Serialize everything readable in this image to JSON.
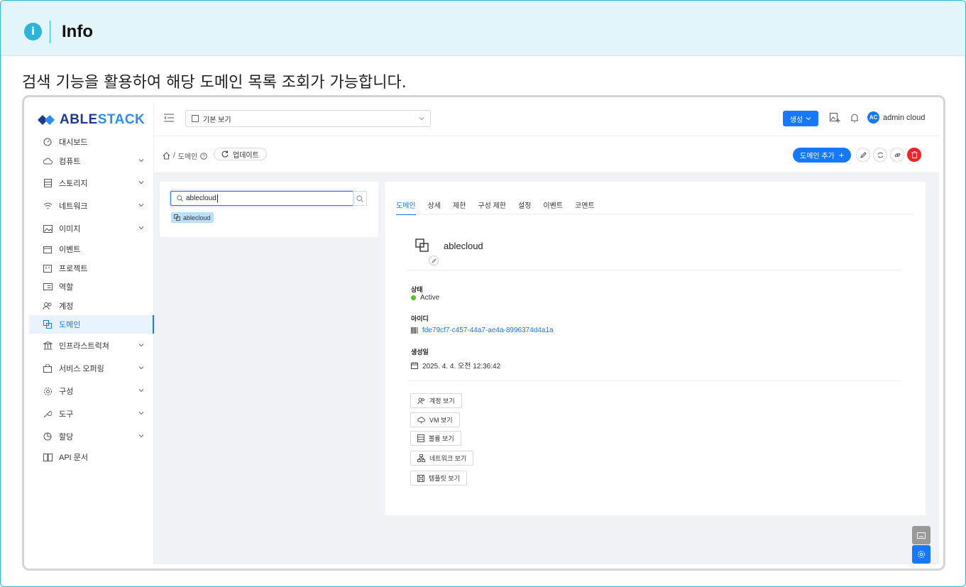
{
  "info": {
    "title": "Info",
    "icon": "info-icon"
  },
  "intro": "검색 기능을 활용하여 해당 도메인 목록 조회가 가능합니다.",
  "brand": {
    "logo_prefix": "ABLE",
    "logo_suffix": "STACK"
  },
  "sidebar": {
    "items": [
      {
        "label": "대시보드",
        "icon": "dashboard-icon",
        "has_children": false
      },
      {
        "label": "컴퓨트",
        "icon": "cloud-icon",
        "has_children": true
      },
      {
        "label": "스토리지",
        "icon": "storage-icon",
        "has_children": true
      },
      {
        "label": "네트워크",
        "icon": "wifi-icon",
        "has_children": true
      },
      {
        "label": "이미지",
        "icon": "image-icon",
        "has_children": true
      },
      {
        "label": "이벤트",
        "icon": "event-icon",
        "has_children": false
      },
      {
        "label": "프로젝트",
        "icon": "project-icon",
        "has_children": false
      },
      {
        "label": "역할",
        "icon": "role-icon",
        "has_children": false
      },
      {
        "label": "계정",
        "icon": "account-icon",
        "has_children": false
      },
      {
        "label": "도메인",
        "icon": "domain-icon",
        "has_children": false,
        "active": true
      },
      {
        "label": "인프라스트럭쳐",
        "icon": "bank-icon",
        "has_children": true
      },
      {
        "label": "서비스 오퍼링",
        "icon": "shopping-icon",
        "has_children": true
      },
      {
        "label": "구성",
        "icon": "settings-icon",
        "has_children": true
      },
      {
        "label": "도구",
        "icon": "tool-icon",
        "has_children": true
      },
      {
        "label": "할당",
        "icon": "pie-chart-icon",
        "has_children": true
      },
      {
        "label": "API 문서",
        "icon": "book-icon",
        "has_children": false
      }
    ]
  },
  "topbar": {
    "view_select": "기본 보기",
    "create_label": "생성",
    "user_initials": "AC",
    "user_name": "admin cloud"
  },
  "breadcrumb": {
    "current": "도메인",
    "refresh_label": "업데이트",
    "add_label": "도메인 추가"
  },
  "search": {
    "value": "ablecloud"
  },
  "tree": {
    "node_label": "ablecloud"
  },
  "tabs": [
    "도메인",
    "상세",
    "제한",
    "구성 제한",
    "설정",
    "이벤트",
    "코멘트"
  ],
  "detail": {
    "name": "ablecloud",
    "status_label": "상태",
    "status_value": "Active",
    "status_color": "#52c41a",
    "id_label": "아이디",
    "id_value": "fde79cf7-c457-44a7-ae4a-8996374d4a1a",
    "created_label": "생성일",
    "created_value": "2025. 4. 4. 오전 12:36:42"
  },
  "actions": [
    "계정 보기",
    "VM 보기",
    "볼륨 보기",
    "네트워크 보기",
    "템플릿 보기"
  ],
  "colors": {
    "primary": "#1677ff",
    "info_accent": "#2db5d8",
    "danger": "#f5222d"
  }
}
